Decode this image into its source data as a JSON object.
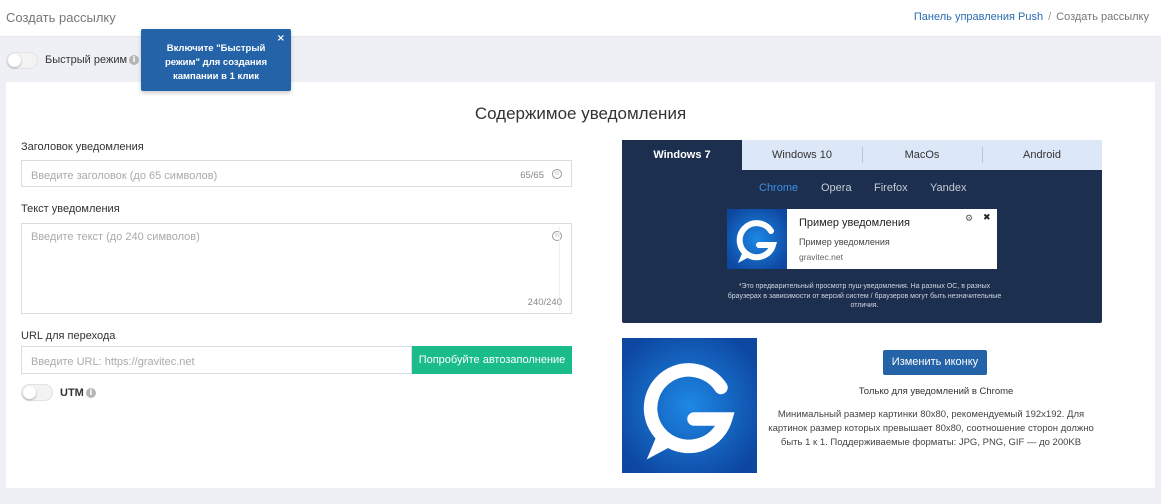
{
  "header": {
    "title": "Создать рассылку",
    "breadcrumb": {
      "link": "Панель управления Push",
      "separator": "/",
      "current": "Создать рассылку"
    }
  },
  "fast_mode": {
    "label": "Быстрый режим",
    "info_icon": "info-icon",
    "tooltip": "Включите \"Быстрый режим\" для создания кампании в 1 клик",
    "tooltip_close": "×"
  },
  "form": {
    "section_title": "Содержимое уведомления",
    "title_field": {
      "label": "Заголовок уведомления",
      "placeholder": "Введите заголовок (до 65 символов)",
      "counter": "65/65",
      "emoji_icon": "smile-icon"
    },
    "text_field": {
      "label": "Текст уведомления",
      "placeholder": "Введите текст (до 240 символов)",
      "counter": "240/240",
      "emoji_icon": "smile-icon"
    },
    "url_field": {
      "label": "URL для перехода",
      "placeholder": "Введите URL: https://gravitec.net",
      "autofill_button": "Попробуйте автозаполнение"
    },
    "utm": {
      "label": "UTM"
    }
  },
  "preview": {
    "os_tabs": [
      "Windows 7",
      "Windows 10",
      "MacOs",
      "Android"
    ],
    "active_os": "Windows 7",
    "browser_tabs": [
      "Chrome",
      "Opera",
      "Firefox",
      "Yandex"
    ],
    "active_browser": "Chrome",
    "notification": {
      "title": "Пример уведомления",
      "text": "Пример уведомления",
      "site": "gravitec.net",
      "gear": "⚙",
      "close": "✖"
    },
    "note": "*Это предварительный просмотр пуш-уведомления. На разных ОС, в разных браузерах в зависимости от версий систем / браузеров могут быть незначительные отличия."
  },
  "icon_section": {
    "change_button": "Изменить иконку",
    "chrome_only": "Только для уведомлений в Chrome",
    "description": "Минимальный размер картинки 80x80, рекомендуемый 192x192. Для картинок размер которых превышает 80x80, соотношение сторон должно быть 1 к 1. Поддерживаемые форматы: JPG, PNG, GIF — до 200KB"
  },
  "colors": {
    "accent": "#2563a8",
    "autofill": "#1abc8a",
    "preview_bg": "#1d2f4e",
    "logo_bg": "#1565c0"
  }
}
